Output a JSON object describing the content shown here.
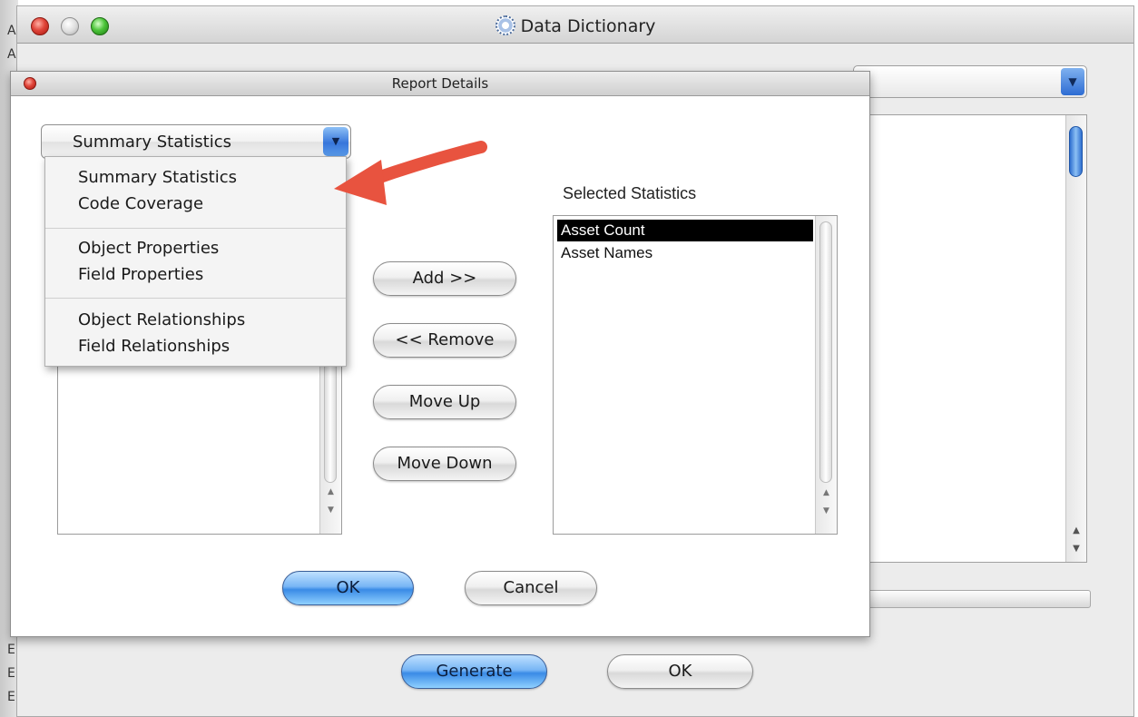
{
  "desktop": {
    "edge_letters": [
      "A",
      "A",
      "E",
      "E",
      "E"
    ]
  },
  "main_window": {
    "title": "Data Dictionary",
    "buttons": {
      "generate": "Generate",
      "ok": "OK"
    }
  },
  "dialog": {
    "title": "Report Details",
    "report_type": {
      "selected": "Summary Statistics",
      "options": [
        [
          "Summary Statistics",
          "Code Coverage"
        ],
        [
          "Object Properties",
          "Field Properties"
        ],
        [
          "Object Relationships",
          "Field Relationships"
        ]
      ]
    },
    "buttons": {
      "add": "Add >>",
      "remove": "<< Remove",
      "move_up": "Move Up",
      "move_down": "Move Down",
      "ok": "OK",
      "cancel": "Cancel"
    },
    "selected_statistics": {
      "label": "Selected Statistics",
      "items": [
        {
          "label": "Asset Count",
          "selected": true
        },
        {
          "label": "Asset Names",
          "selected": false
        }
      ]
    }
  },
  "colors": {
    "accent_blue": "#3a8be6",
    "callout_arrow": "#e8533f",
    "selection": "#000000"
  },
  "icons": [
    "close-icon",
    "minimize-icon",
    "zoom-icon",
    "gear-icon",
    "chevron-down-icon",
    "scroll-up-arrow-icon",
    "scroll-down-arrow-icon"
  ]
}
